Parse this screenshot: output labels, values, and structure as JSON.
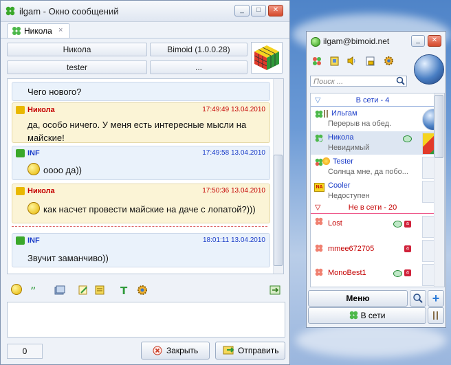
{
  "chat_window": {
    "title": "ilgam - Окно сообщений",
    "tab_label": "Никола",
    "tab_close": "×",
    "info": {
      "nick": "Никола",
      "client": "Bimoid (1.0.0.28)",
      "account": "tester",
      "more": "..."
    },
    "messages": [
      {
        "text": "Чего нового?"
      },
      {
        "sender": "Никола",
        "time": "17:49:49 13.04.2010",
        "text": "да, особо ничего. У меня есть интересные мысли на майские!"
      },
      {
        "sender": "INF",
        "time": "17:49:58 13.04.2010",
        "text": "оооо да))"
      },
      {
        "sender": "Никола",
        "time": "17:50:36 13.04.2010",
        "text": "как насчет провести майские на даче с лопатой?)))"
      },
      {
        "sender": "INF",
        "time": "18:01:11 13.04.2010",
        "text": "Звучит заманчиво))"
      }
    ],
    "input_value": "",
    "counter": "0",
    "close_label": "Закрыть",
    "send_label": "Отправить",
    "window_buttons": {
      "minimize": "_",
      "maximize": "□",
      "close": "✕"
    }
  },
  "contact_list": {
    "title": "ilgam@bimoid.net",
    "search_placeholder": "Поиск ...",
    "online_group": "В сети - 4",
    "offline_group": "Не в сети - 20",
    "online_contacts": [
      {
        "name": "Ильгам",
        "status": "Перерыв на обед."
      },
      {
        "name": "Никола",
        "status": "Невидимый"
      },
      {
        "name": "Tester",
        "status": "Солнца мне, да побо..."
      },
      {
        "name": "Cooler",
        "status": "Недоступен"
      }
    ],
    "offline_contacts": [
      {
        "name": "Lost"
      },
      {
        "name": "mmee672705"
      },
      {
        "name": "MonoBest1"
      }
    ],
    "menu_label": "Меню",
    "status_label": "В сети",
    "colors": {
      "offline": "#c40000",
      "online": "#1a3cc8",
      "status_green": "#2e9a17"
    }
  }
}
